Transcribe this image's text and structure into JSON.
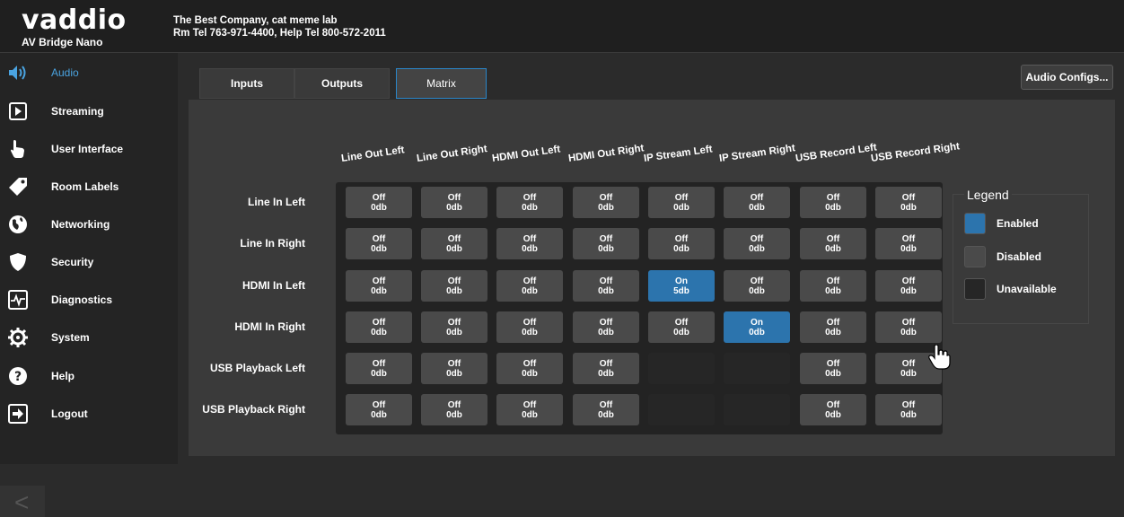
{
  "header": {
    "logo": "vaddio",
    "product": "AV Bridge Nano",
    "company": "The Best Company, cat meme lab",
    "phones": "Rm Tel 763-971-4400, Help Tel 800-572-2011"
  },
  "sidebar": {
    "items": [
      {
        "label": "Audio",
        "icon": "speaker-icon",
        "active": true
      },
      {
        "label": "Streaming",
        "icon": "play-icon"
      },
      {
        "label": "User Interface",
        "icon": "hand-pointer-icon"
      },
      {
        "label": "Room Labels",
        "icon": "tag-icon"
      },
      {
        "label": "Networking",
        "icon": "globe-icon"
      },
      {
        "label": "Security",
        "icon": "shield-icon"
      },
      {
        "label": "Diagnostics",
        "icon": "pulse-icon"
      },
      {
        "label": "System",
        "icon": "gear-icon"
      },
      {
        "label": "Help",
        "icon": "question-icon"
      },
      {
        "label": "Logout",
        "icon": "logout-icon"
      }
    ],
    "collapse_glyph": "<"
  },
  "tabs": [
    {
      "label": "Inputs"
    },
    {
      "label": "Outputs"
    },
    {
      "label": "Matrix",
      "active": true
    }
  ],
  "audio_configs_label": "Audio Configs...",
  "matrix": {
    "columns": [
      "Line Out Left",
      "Line Out Right",
      "HDMI Out Left",
      "HDMI Out Right",
      "IP Stream Left",
      "IP Stream Right",
      "USB Record Left",
      "USB Record Right"
    ],
    "rows": [
      {
        "label": "Line In Left",
        "cells": [
          {
            "state": "Off",
            "level": "0db"
          },
          {
            "state": "Off",
            "level": "0db"
          },
          {
            "state": "Off",
            "level": "0db"
          },
          {
            "state": "Off",
            "level": "0db"
          },
          {
            "state": "Off",
            "level": "0db"
          },
          {
            "state": "Off",
            "level": "0db"
          },
          {
            "state": "Off",
            "level": "0db"
          },
          {
            "state": "Off",
            "level": "0db"
          }
        ]
      },
      {
        "label": "Line In Right",
        "cells": [
          {
            "state": "Off",
            "level": "0db"
          },
          {
            "state": "Off",
            "level": "0db"
          },
          {
            "state": "Off",
            "level": "0db"
          },
          {
            "state": "Off",
            "level": "0db"
          },
          {
            "state": "Off",
            "level": "0db"
          },
          {
            "state": "Off",
            "level": "0db"
          },
          {
            "state": "Off",
            "level": "0db"
          },
          {
            "state": "Off",
            "level": "0db"
          }
        ]
      },
      {
        "label": "HDMI In Left",
        "cells": [
          {
            "state": "Off",
            "level": "0db"
          },
          {
            "state": "Off",
            "level": "0db"
          },
          {
            "state": "Off",
            "level": "0db"
          },
          {
            "state": "Off",
            "level": "0db"
          },
          {
            "state": "On",
            "level": "5db"
          },
          {
            "state": "Off",
            "level": "0db"
          },
          {
            "state": "Off",
            "level": "0db"
          },
          {
            "state": "Off",
            "level": "0db"
          }
        ]
      },
      {
        "label": "HDMI In Right",
        "cells": [
          {
            "state": "Off",
            "level": "0db"
          },
          {
            "state": "Off",
            "level": "0db"
          },
          {
            "state": "Off",
            "level": "0db"
          },
          {
            "state": "Off",
            "level": "0db"
          },
          {
            "state": "Off",
            "level": "0db"
          },
          {
            "state": "On",
            "level": "0db"
          },
          {
            "state": "Off",
            "level": "0db"
          },
          {
            "state": "Off",
            "level": "0db"
          }
        ]
      },
      {
        "label": "USB Playback Left",
        "cells": [
          {
            "state": "Off",
            "level": "0db"
          },
          {
            "state": "Off",
            "level": "0db"
          },
          {
            "state": "Off",
            "level": "0db"
          },
          {
            "state": "Off",
            "level": "0db"
          },
          {
            "state": "unavailable",
            "level": ""
          },
          {
            "state": "unavailable",
            "level": ""
          },
          {
            "state": "Off",
            "level": "0db"
          },
          {
            "state": "Off",
            "level": "0db"
          }
        ]
      },
      {
        "label": "USB Playback Right",
        "cells": [
          {
            "state": "Off",
            "level": "0db"
          },
          {
            "state": "Off",
            "level": "0db"
          },
          {
            "state": "Off",
            "level": "0db"
          },
          {
            "state": "Off",
            "level": "0db"
          },
          {
            "state": "unavailable",
            "level": ""
          },
          {
            "state": "unavailable",
            "level": ""
          },
          {
            "state": "Off",
            "level": "0db"
          },
          {
            "state": "Off",
            "level": "0db"
          }
        ]
      }
    ]
  },
  "legend": {
    "title": "Legend",
    "items": [
      {
        "label": "Enabled",
        "color": "#2c74ad"
      },
      {
        "label": "Disabled",
        "color": "#4a4a4a"
      },
      {
        "label": "Unavailable",
        "color": "#262626"
      }
    ]
  },
  "colors": {
    "accent": "#4aa3e0",
    "enabled": "#2c74ad",
    "disabled": "#4a4a4a",
    "unavailable": "#262626"
  }
}
